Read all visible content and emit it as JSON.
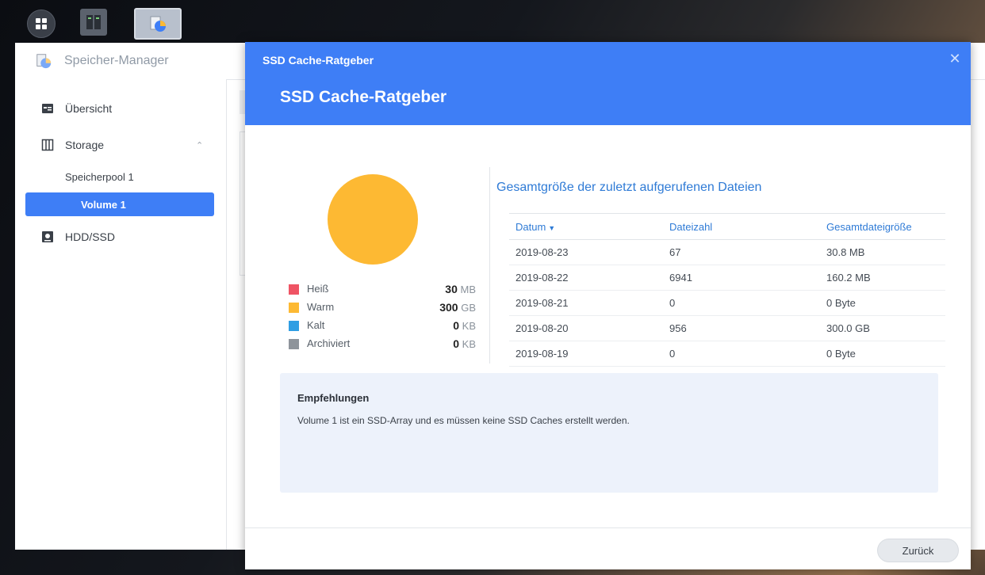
{
  "taskbar": {
    "menu_icon": "grid-menu-icon",
    "apps": [
      {
        "icon": "server-rack-icon"
      },
      {
        "icon": "storage-manager-icon"
      }
    ]
  },
  "storage_manager": {
    "title": "Speicher-Manager",
    "sidebar": {
      "items": [
        {
          "label": "Übersicht",
          "icon": "overview-icon"
        },
        {
          "label": "Storage",
          "icon": "storage-icon"
        },
        {
          "label": "Speicherpool 1"
        },
        {
          "label": "Volume 1"
        },
        {
          "label": "HDD/SSD",
          "icon": "disk-icon"
        }
      ]
    }
  },
  "modal": {
    "topbar_title": "SSD Cache-Ratgeber",
    "title": "SSD Cache-Ratgeber",
    "close_icon": "close-icon",
    "legend": [
      {
        "name": "Heiß",
        "value": "30",
        "unit": "MB",
        "color": "#ef5464"
      },
      {
        "name": "Warm",
        "value": "300",
        "unit": "GB",
        "color": "#fdb933"
      },
      {
        "name": "Kalt",
        "value": "0",
        "unit": "KB",
        "color": "#2f9ee3"
      },
      {
        "name": "Archiviert",
        "value": "0",
        "unit": "KB",
        "color": "#8e949b"
      }
    ],
    "section_title": "Gesamtgröße der zuletzt aufgerufenen Dateien",
    "table": {
      "columns": [
        "Datum",
        "Dateizahl",
        "Gesamtdateigröße"
      ],
      "rows": [
        [
          "2019-08-23",
          "67",
          "30.8 MB"
        ],
        [
          "2019-08-22",
          "6941",
          "160.2 MB"
        ],
        [
          "2019-08-21",
          "0",
          "0 Byte"
        ],
        [
          "2019-08-20",
          "956",
          "300.0 GB"
        ],
        [
          "2019-08-19",
          "0",
          "0 Byte"
        ]
      ]
    },
    "recommendation": {
      "title": "Empfehlungen",
      "text": "Volume 1 ist ein SSD-Array und es müssen keine SSD Caches erstellt werden."
    },
    "back_button": "Zurück"
  },
  "colors": {
    "accent": "#3e7ef6",
    "link": "#2f7bd6"
  }
}
